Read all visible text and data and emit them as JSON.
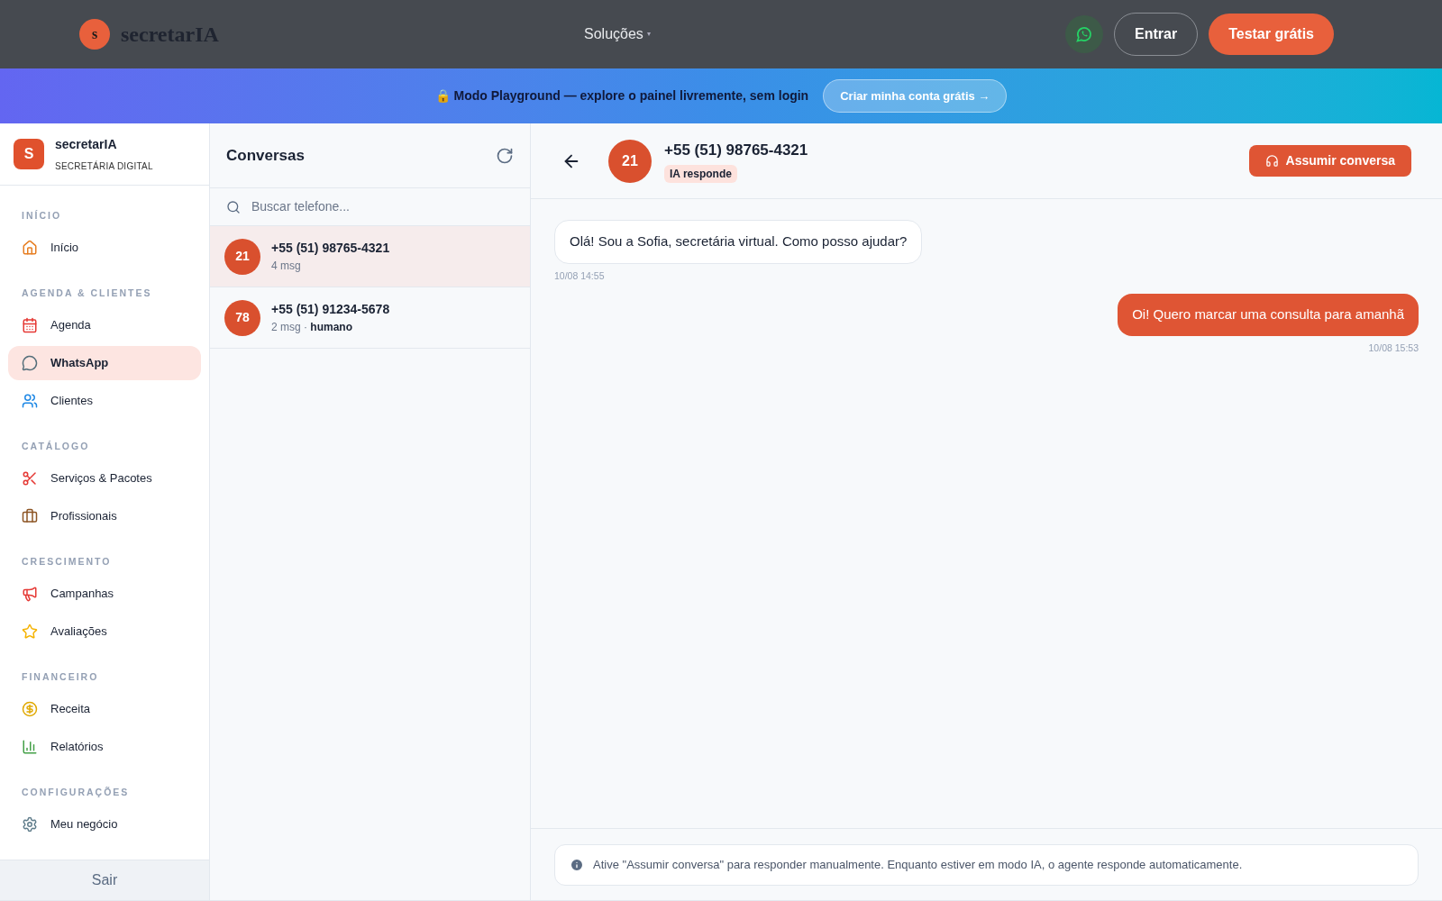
{
  "topbar": {
    "logo_letter": "s",
    "brand": "secretarIA",
    "nav": "Soluções",
    "nav_caret": "▾",
    "login": "Entrar",
    "cta": "Testar grátis"
  },
  "banner": {
    "lock": "🔒",
    "text": "Modo Playground — explore o painel livremente, sem login",
    "button": "Criar minha conta grátis →"
  },
  "sidebar": {
    "logo_letter": "S",
    "name": "secretarIA",
    "tagline": "SECRETÁRIA DIGITAL",
    "sections": [
      {
        "title": "INÍCIO",
        "items": [
          {
            "label": "Início",
            "selected": false
          }
        ]
      },
      {
        "title": "AGENDA & CLIENTES",
        "items": [
          {
            "label": "Agenda",
            "selected": false
          },
          {
            "label": "WhatsApp",
            "selected": true
          },
          {
            "label": "Clientes",
            "selected": false
          }
        ]
      },
      {
        "title": "CATÁLOGO",
        "items": [
          {
            "label": "Serviços & Pacotes",
            "selected": false
          },
          {
            "label": "Profissionais",
            "selected": false
          }
        ]
      },
      {
        "title": "CRESCIMENTO",
        "items": [
          {
            "label": "Campanhas",
            "selected": false
          },
          {
            "label": "Avaliações",
            "selected": false
          }
        ]
      },
      {
        "title": "FINANCEIRO",
        "items": [
          {
            "label": "Receita",
            "selected": false
          },
          {
            "label": "Relatórios",
            "selected": false
          }
        ]
      },
      {
        "title": "CONFIGURAÇÕES",
        "items": [
          {
            "label": "Meu negócio",
            "selected": false
          }
        ]
      }
    ],
    "logout": "Sair"
  },
  "conversations": {
    "title": "Conversas",
    "search": {
      "placeholder": "Buscar telefone..."
    },
    "items": [
      {
        "avatar": "21",
        "phone": "+55 (51) 98765-4321",
        "meta": "4 msg",
        "selected": true
      },
      {
        "avatar": "78",
        "phone": "+55 (51) 91234-5678",
        "meta": "2 msg · ",
        "mode": "humano",
        "selected": false
      }
    ]
  },
  "chat": {
    "avatar": "21",
    "phone": "+55 (51) 98765-4321",
    "status": "IA responde",
    "take_over": "Assumir conversa",
    "messages": [
      {
        "kind": "received",
        "text": "Olá! Sou a Sofia, secretária virtual. Como posso ajudar?",
        "time": "10/08 14:55"
      },
      {
        "kind": "sent",
        "text": "Oi! Quero marcar uma consulta para amanhã",
        "time": "10/08 15:53"
      }
    ],
    "notice": "Ative \"Assumir conversa\" para responder manualmente. Enquanto estiver em modo IA, o agente responde automaticamente."
  }
}
